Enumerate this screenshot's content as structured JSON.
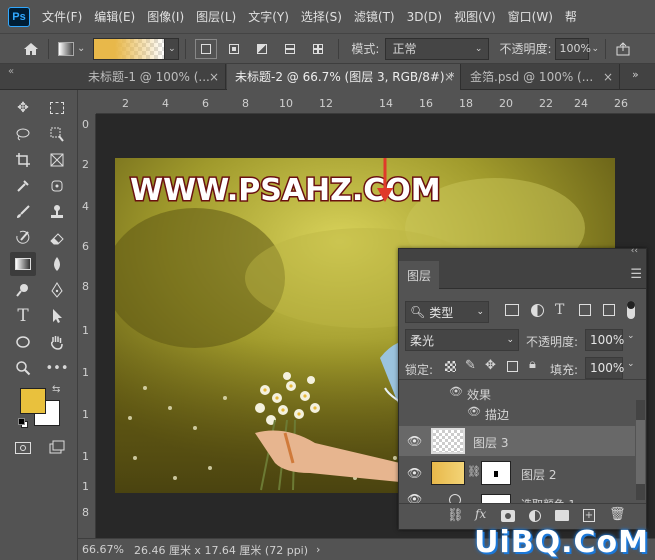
{
  "app": {
    "logo": "Ps"
  },
  "menu": [
    "文件(F)",
    "编辑(E)",
    "图像(I)",
    "图层(L)",
    "文字(Y)",
    "选择(S)",
    "滤镜(T)",
    "3D(D)",
    "视图(V)",
    "窗口(W)",
    "帮"
  ],
  "options": {
    "mode_label": "模式:",
    "mode_value": "正常",
    "opacity_label": "不透明度:",
    "opacity_value": "100%",
    "gradient_colors": [
      "#e8b84a",
      "#ffffff"
    ]
  },
  "tabs": [
    {
      "label": "未标题-1 @ 100% (..."
    },
    {
      "label": "未标题-2 @ 66.7% (图层 3, RGB/8#) *"
    },
    {
      "label": "金箔.psd @ 100% (..."
    }
  ],
  "ruler": {
    "top": [
      "2",
      "4",
      "6",
      "8",
      "10",
      "12",
      "14",
      "16",
      "18",
      "20",
      "22",
      "24",
      "26"
    ],
    "left": [
      "0",
      "2",
      "4",
      "6",
      "8",
      "1",
      "1",
      "1",
      "1",
      "1",
      "8"
    ]
  },
  "canvas": {
    "watermark": "WWW.PSAHZ.COM"
  },
  "colors": {
    "foreground": "#e9c13d",
    "background": "#ffffff"
  },
  "status": {
    "zoom": "66.67%",
    "doc_size": "26.46 厘米 x 17.64 厘米 (72 ppi)",
    "arrow": "›"
  },
  "layers_panel": {
    "tab_title": "图层",
    "filter_label": "类型",
    "blend_mode": "柔光",
    "opacity_label": "不透明度:",
    "opacity_value": "100%",
    "lock_label": "锁定:",
    "fill_label": "填充:",
    "fill_value": "100%",
    "effects_label": "效果",
    "stroke_label": "描边",
    "layers": [
      {
        "name": "图层 3"
      },
      {
        "name": "图层 2"
      },
      {
        "name": "选取颜色 1"
      }
    ]
  },
  "site_watermark": "UiBQ.CoM"
}
